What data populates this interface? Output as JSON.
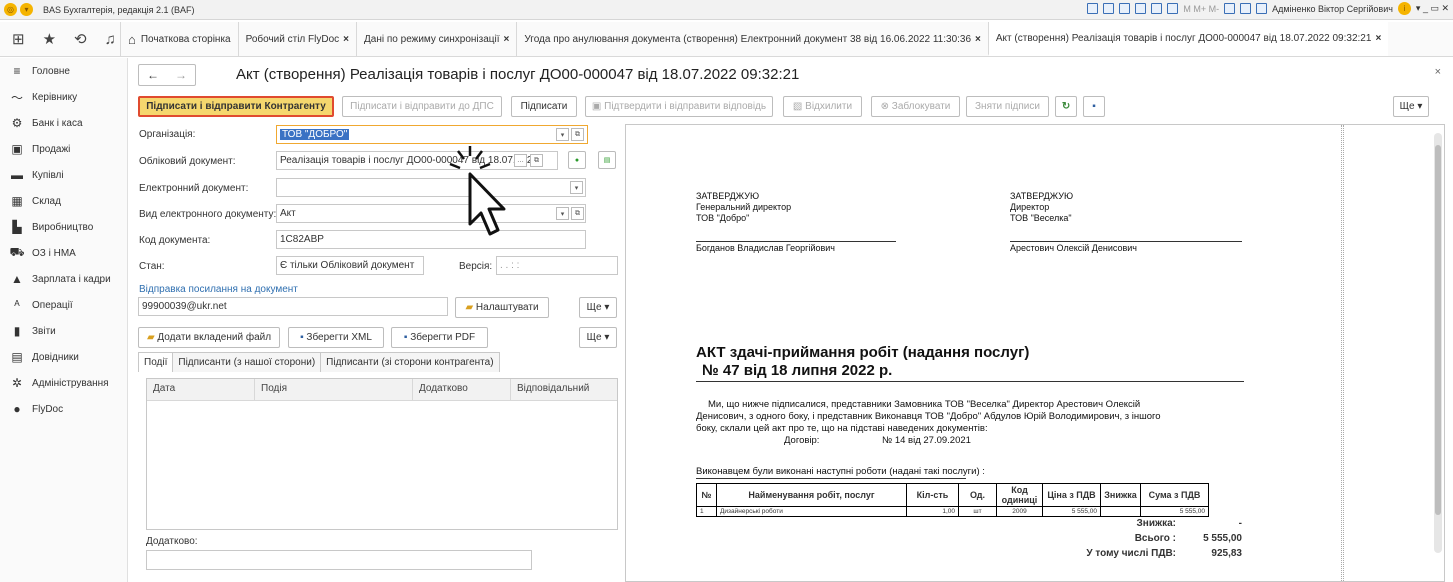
{
  "titlebar": {
    "app_title": "BAS Бухгалтерія, редакція 2.1  (BAF)",
    "user": "Адміненко Віктор Сергійович",
    "mem": "M  M+  M-"
  },
  "tabs": [
    {
      "label": "Початкова сторінка"
    },
    {
      "label": "Робочий стіл FlyDoc"
    },
    {
      "label": "Дані по режиму синхронізації"
    },
    {
      "label": "Угода про анулювання документа (створення)  Електронний документ 38 від 16.06.2022 11:30:36"
    },
    {
      "label": "Акт (створення) Реалізація товарів і послуг ДО00-000047 від 18.07.2022 09:32:21"
    }
  ],
  "sidebar": {
    "items": [
      {
        "label": "Головне",
        "icon": "≡"
      },
      {
        "label": "Керівнику",
        "icon": "〜"
      },
      {
        "label": "Банк і каса",
        "icon": "⚙"
      },
      {
        "label": "Продажі",
        "icon": "▣"
      },
      {
        "label": "Купівлі",
        "icon": "▬"
      },
      {
        "label": "Склад",
        "icon": "▦"
      },
      {
        "label": "Виробництво",
        "icon": "▙"
      },
      {
        "label": "ОЗ і НМА",
        "icon": "⛟"
      },
      {
        "label": "Зарплата і кадри",
        "icon": "▲"
      },
      {
        "label": "Операції",
        "icon": "ᴬ"
      },
      {
        "label": "Звіти",
        "icon": "▮"
      },
      {
        "label": "Довідники",
        "icon": "▤"
      },
      {
        "label": "Адміністрування",
        "icon": "✲"
      },
      {
        "label": "FlyDoc",
        "icon": "●"
      }
    ]
  },
  "doc": {
    "title": "Акт (створення) Реалізація товарів і послуг ДО00-000047 від 18.07.2022 09:32:21"
  },
  "toolbar": {
    "sign_send_counterparty": "Підписати і відправити Контрагенту",
    "sign_send_dps": "Підписати і відправити до ДПС",
    "sign": "Підписати",
    "confirm_reply": "Підтвердити і відправити відповідь",
    "reject": "Відхилити",
    "block": "Заблокувати",
    "remove_sign": "Зняти підписи",
    "more": "Ще"
  },
  "form": {
    "org_label": "Організація:",
    "org_value": "ТОВ \"ДОБРО\"",
    "acc_doc_label": "Обліковий документ:",
    "acc_doc_value": "Реалізація товарів і послуг ДО00-000047 від 18.07.202",
    "edoc_label": "Електронний документ:",
    "edoc_value": "",
    "edoc_type_label": "Вид електронного документу:",
    "edoc_type_value": "Акт",
    "doc_code_label": "Код документа:",
    "doc_code_value": "1С82АВР",
    "state_label": "Стан:",
    "state_value": "Є тільки Обліковий документ",
    "version_label": "Версія:",
    "version_value": " .  .       :  :",
    "link_label": "Відправка посилання на документ",
    "email_value": "99900039@ukr.net",
    "setup_btn": "Налаштувати",
    "more": "Ще",
    "add_file": "Додати вкладений файл",
    "save_xml": "Зберегти XML",
    "save_pdf": "Зберегти PDF"
  },
  "subtabs": [
    {
      "label": "Події"
    },
    {
      "label": "Підписанти (з нашої сторони)"
    },
    {
      "label": "Підписанти (зі сторони контрагента)"
    }
  ],
  "grid": {
    "columns": [
      "Дата",
      "Подія",
      "Додатково",
      "Відповідальний"
    ]
  },
  "extra_label": "Додатково:",
  "preview": {
    "left": {
      "head": "ЗАТВЕРДЖУЮ",
      "role": "Генеральний директор",
      "org": "ТОВ \"Добро\"",
      "name": "Богданов Владислав Георгійович"
    },
    "right": {
      "head": "ЗАТВЕРДЖУЮ",
      "role": "Директор",
      "org": "ТОВ \"Веселка\"",
      "name": "Арестович Олексій Денисович"
    },
    "title1": "АКТ здачі-приймання робіт (надання послуг)",
    "title2": "№ 47 від 18 липня 2022 р.",
    "body1": "Ми, що нижче підписалися, представники Замовника ТОВ \"Веселка\" Директор Арестович Олексій",
    "body2": "Денисович, з одного боку, і представник Виконавця ТОВ \"Добро\" Абдулов Юрій Володимирович, з іншого",
    "body3": "боку, склали цей акт про те, що на підставі наведених документів:",
    "contract_label": "Договір:",
    "contract_value": "№ 14 від 27.09.2021",
    "done_text": "Виконавцем були виконані наступні роботи (надані такі послуги) :",
    "table_head": [
      "№",
      "Найменування робіт, послуг",
      "Кіл-сть",
      "Од.",
      "Код одиниці",
      "Ціна з ПДВ",
      "Знижка",
      "Сума з ПДВ"
    ],
    "table_row": [
      "1",
      "Дизайнерські роботи",
      "1,00",
      "шт",
      "2009",
      "5 555,00",
      "",
      "5 555,00"
    ],
    "discount_label": "Знижка:",
    "discount_value": "-",
    "total_label": "Всього :",
    "total_value": "5 555,00",
    "vat_label": "У тому числі ПДВ:",
    "vat_value": "925,83"
  }
}
